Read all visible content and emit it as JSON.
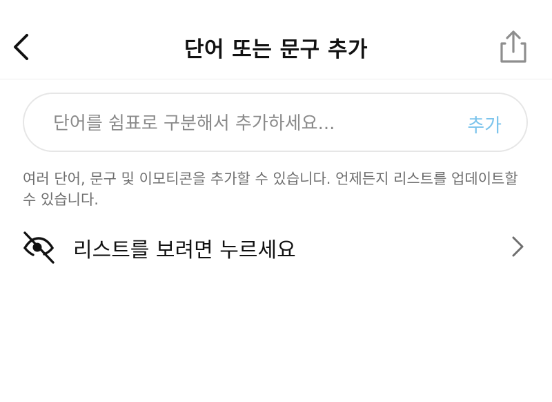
{
  "header": {
    "title": "단어 또는 문구 추가",
    "back_icon": "chevron-left-icon",
    "share_icon": "share-icon"
  },
  "input": {
    "placeholder": "단어를 쉼표로 구분해서 추가하세요...",
    "value": "",
    "add_label": "추가"
  },
  "helper": {
    "text": "여러 단어, 문구 및 이모티콘을 추가할 수 있습니다. 언제든지 리스트를 업데이트할 수 있습니다."
  },
  "list_row": {
    "label": "리스트를 보려면 누르세요",
    "icon": "eye-off-icon",
    "chevron_icon": "chevron-right-icon"
  },
  "colors": {
    "accent": "#7cc4ec",
    "text_primary": "#111111",
    "text_secondary": "#6e6e6e",
    "placeholder": "#8a8a8a",
    "border": "#e6e6e6"
  }
}
